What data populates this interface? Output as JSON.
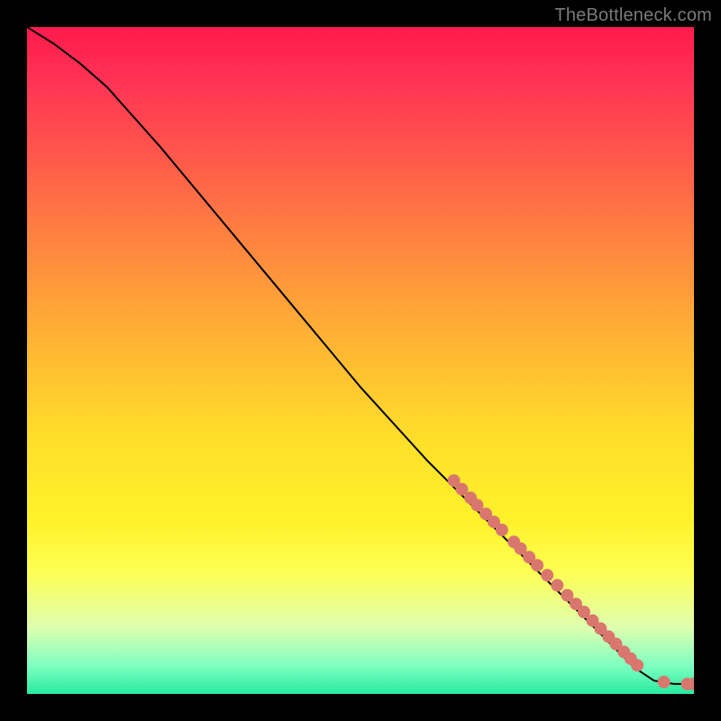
{
  "attribution": "TheBottleneck.com",
  "colors": {
    "gradient_top": "#ff1a4d",
    "gradient_bottom": "#27e9a0",
    "curve": "#000000",
    "dot": "#d9776e",
    "frame": "#000000"
  },
  "chart_data": {
    "type": "line",
    "title": "",
    "xlabel": "",
    "ylabel": "",
    "xlim": [
      0,
      100
    ],
    "ylim": [
      0,
      100
    ],
    "grid": false,
    "legend": false,
    "curve": [
      {
        "x": 0.0,
        "y": 100.0
      },
      {
        "x": 4.0,
        "y": 97.5
      },
      {
        "x": 8.0,
        "y": 94.5
      },
      {
        "x": 12.0,
        "y": 91.0
      },
      {
        "x": 20.0,
        "y": 82.0
      },
      {
        "x": 30.0,
        "y": 70.0
      },
      {
        "x": 40.0,
        "y": 58.0
      },
      {
        "x": 50.0,
        "y": 46.0
      },
      {
        "x": 60.0,
        "y": 35.0
      },
      {
        "x": 68.0,
        "y": 27.0
      },
      {
        "x": 74.0,
        "y": 21.0
      },
      {
        "x": 80.0,
        "y": 15.0
      },
      {
        "x": 84.0,
        "y": 11.0
      },
      {
        "x": 88.0,
        "y": 7.0
      },
      {
        "x": 91.0,
        "y": 4.0
      },
      {
        "x": 94.0,
        "y": 2.0
      },
      {
        "x": 97.0,
        "y": 1.5
      },
      {
        "x": 100.0,
        "y": 1.5
      }
    ],
    "series": [
      {
        "name": "points",
        "type": "scatter",
        "x": [
          64.0,
          65.2,
          66.5,
          67.5,
          68.8,
          70.0,
          71.2,
          73.0,
          74.0,
          75.3,
          76.5,
          78.0,
          79.5,
          81.0,
          82.3,
          83.5,
          84.8,
          86.0,
          87.2,
          88.3,
          89.5,
          90.5,
          91.5,
          95.5,
          99.0,
          100.0
        ],
        "y": [
          32.0,
          30.7,
          29.4,
          28.3,
          27.0,
          25.8,
          24.6,
          22.8,
          21.8,
          20.5,
          19.3,
          17.8,
          16.3,
          14.8,
          13.5,
          12.3,
          11.0,
          9.8,
          8.6,
          7.5,
          6.3,
          5.3,
          4.3,
          1.8,
          1.5,
          1.5
        ]
      }
    ]
  }
}
